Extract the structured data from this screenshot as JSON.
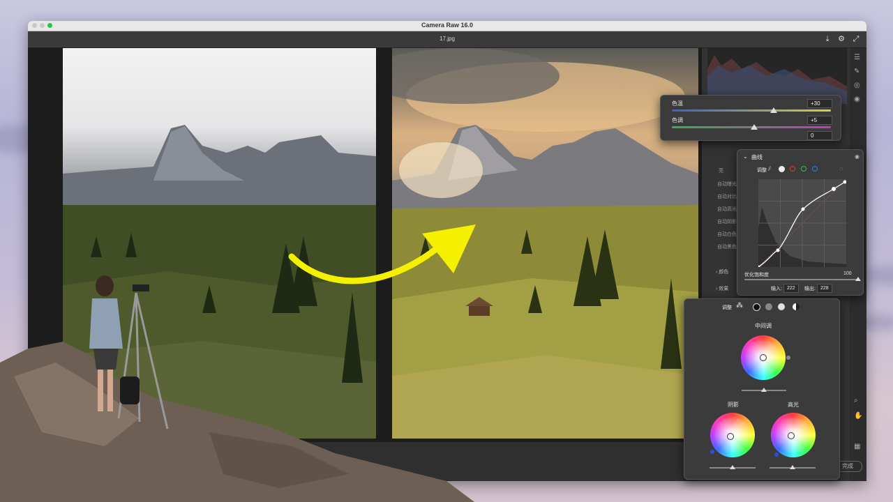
{
  "window": {
    "title": "Camera Raw 16.0",
    "file_name": "17.jpg"
  },
  "temp_tint_panel": {
    "temp_label": "色温",
    "temp_value": "+30",
    "tint_label": "色调",
    "tint_value": "+5",
    "third_value": "0"
  },
  "basic_panel": {
    "section_label": "亮",
    "items": [
      "自动曝光",
      "自动对比",
      "自动高光",
      "自动阴影",
      "自动白色",
      "自动黑色"
    ],
    "sections": [
      "颜色",
      "效果",
      "曲线"
    ]
  },
  "curve_panel": {
    "title": "曲线",
    "adjust_label": "调整",
    "refine_label": "优化饱和度",
    "refine_value": "100",
    "input_label": "输入:",
    "input_value": "222",
    "output_label": "输出:",
    "output_value": "228",
    "channel_colors": [
      "#ffffff",
      "#e23b3b",
      "#3bbf45",
      "#3b7bea"
    ]
  },
  "grading_panel": {
    "adjust_label": "调整",
    "midtones_label": "中间调",
    "shadows_label": "阴影",
    "highlights_label": "高光",
    "mode_icons": [
      "three-way-icon",
      "shadows-icon",
      "midtones-icon",
      "highlights-icon",
      "global-icon"
    ]
  },
  "bottom": {
    "done_label": "完成"
  },
  "colors": {
    "accent_yellow": "#f5f000",
    "panel_bg": "#3b3b3b",
    "window_bg": "#2a2a2a"
  }
}
